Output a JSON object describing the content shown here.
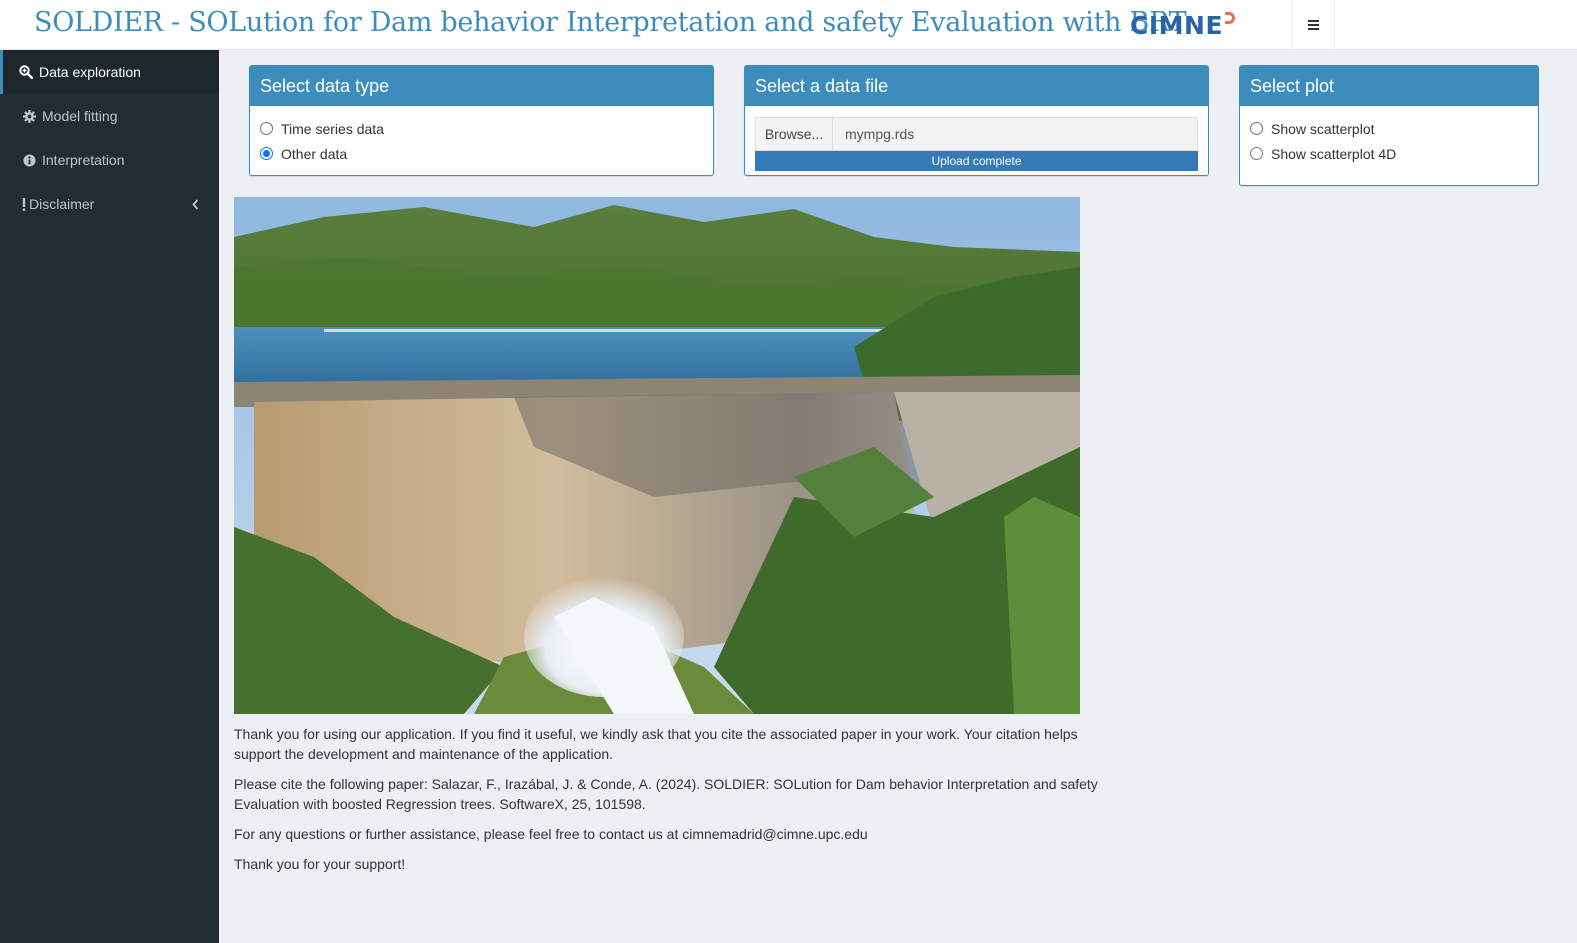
{
  "header": {
    "title": "SOLDIER - SOLution for Dam behavior Interpretation and safety Evaluation with BRT",
    "logo_text": "CIMNE",
    "toggle_icon": "hamburger-menu-icon"
  },
  "sidebar": {
    "items": [
      {
        "label": "Data exploration",
        "icon": "search-plus-icon",
        "active": true
      },
      {
        "label": "Model fitting",
        "icon": "gear-icon",
        "active": false
      },
      {
        "label": "Interpretation",
        "icon": "info-circle-icon",
        "active": false
      },
      {
        "label": "Disclaimer",
        "icon": "exclamation-icon",
        "active": false
      }
    ]
  },
  "data_type_box": {
    "title": "Select data type",
    "options": [
      {
        "label": "Time series data",
        "checked": false
      },
      {
        "label": "Other data",
        "checked": true
      }
    ]
  },
  "file_box": {
    "title": "Select a data file",
    "browse_label": "Browse...",
    "file_name": "mympg.rds",
    "progress_label": "Upload complete",
    "progress": 1.0
  },
  "plot_box": {
    "title": "Select plot",
    "options": [
      {
        "label": "Show scatterplot",
        "checked": false
      },
      {
        "label": "Show scatterplot 4D",
        "checked": false
      }
    ]
  },
  "content": {
    "paragraphs": [
      "Thank you for using our application. If you find it useful, we kindly ask that you cite the associated paper in your work. Your citation helps support the development and maintenance of the application.",
      "Please cite the following paper: Salazar, F., Irazábal, J. & Conde, A. (2024). SOLDIER: SOLution for Dam behavior Interpretation and safety Evaluation with boosted Regression trees. SoftwareX, 25, 101598.",
      "For any questions or further assistance, please feel free to contact us at cimnemadrid@cimne.upc.edu",
      "Thank you for your support!"
    ]
  },
  "colors": {
    "primary": "#3c8dbc",
    "sidebar_bg": "#222d32",
    "content_bg": "#ecf0f5",
    "progress": "#337ab7"
  }
}
